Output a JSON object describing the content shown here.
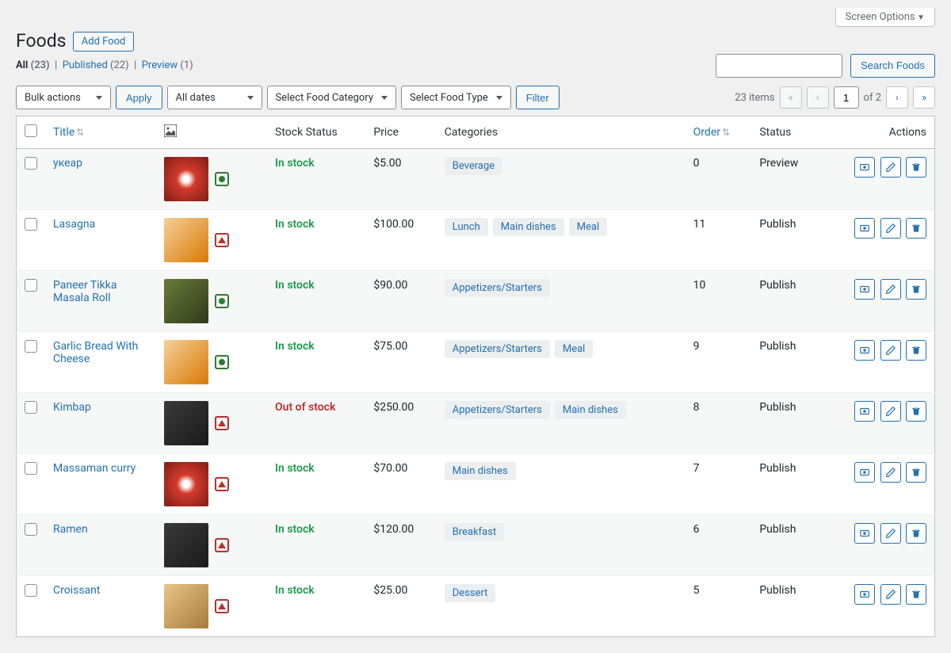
{
  "screen_options_label": "Screen Options",
  "page_title": "Foods",
  "add_button_label": "Add Food",
  "filters": {
    "all_label": "All",
    "all_count": "(23)",
    "published_label": "Published",
    "published_count": "(22)",
    "preview_label": "Preview",
    "preview_count": "(1)"
  },
  "search_button": "Search Foods",
  "bulk_actions_label": "Bulk actions",
  "apply_label": "Apply",
  "dates_label": "All dates",
  "category_label": "Select Food Category",
  "type_label": "Select Food Type",
  "filter_label": "Filter",
  "pagination": {
    "items_text": "23 items",
    "current_page": "1",
    "total_pages_text": "of 2"
  },
  "columns": {
    "title": "Title",
    "stock": "Stock Status",
    "price": "Price",
    "categories": "Categories",
    "order": "Order",
    "status": "Status",
    "actions": "Actions"
  },
  "rows": [
    {
      "title": "укеар",
      "stock": "In stock",
      "stock_class": "in-stock",
      "price": "$5.00",
      "cats": [
        "Beverage"
      ],
      "order": "0",
      "status": "Preview",
      "thumb": "red",
      "badge": "green"
    },
    {
      "title": "Lasagna",
      "stock": "In stock",
      "stock_class": "in-stock",
      "price": "$100.00",
      "cats": [
        "Lunch",
        "Main dishes",
        "Meal"
      ],
      "order": "11",
      "status": "Publish",
      "thumb": "orange",
      "badge": "red"
    },
    {
      "title": "Paneer Tikka Masala Roll",
      "stock": "In stock",
      "stock_class": "in-stock",
      "price": "$90.00",
      "cats": [
        "Appetizers/Starters"
      ],
      "order": "10",
      "status": "Publish",
      "thumb": "green",
      "badge": "green"
    },
    {
      "title": "Garlic Bread With Cheese",
      "stock": "In stock",
      "stock_class": "in-stock",
      "price": "$75.00",
      "cats": [
        "Appetizers/Starters",
        "Meal"
      ],
      "order": "9",
      "status": "Publish",
      "thumb": "orange",
      "badge": "green"
    },
    {
      "title": "Kimbap",
      "stock": "Out of stock",
      "stock_class": "out-stock",
      "price": "$250.00",
      "cats": [
        "Appetizers/Starters",
        "Main dishes"
      ],
      "order": "8",
      "status": "Publish",
      "thumb": "dark",
      "badge": "red"
    },
    {
      "title": "Massaman curry",
      "stock": "In stock",
      "stock_class": "in-stock",
      "price": "$70.00",
      "cats": [
        "Main dishes"
      ],
      "order": "7",
      "status": "Publish",
      "thumb": "red",
      "badge": "red"
    },
    {
      "title": "Ramen",
      "stock": "In stock",
      "stock_class": "in-stock",
      "price": "$120.00",
      "cats": [
        "Breakfast"
      ],
      "order": "6",
      "status": "Publish",
      "thumb": "dark",
      "badge": "red"
    },
    {
      "title": "Croissant",
      "stock": "In stock",
      "stock_class": "in-stock",
      "price": "$25.00",
      "cats": [
        "Dessert"
      ],
      "order": "5",
      "status": "Publish",
      "thumb": "crois",
      "badge": "red"
    }
  ]
}
